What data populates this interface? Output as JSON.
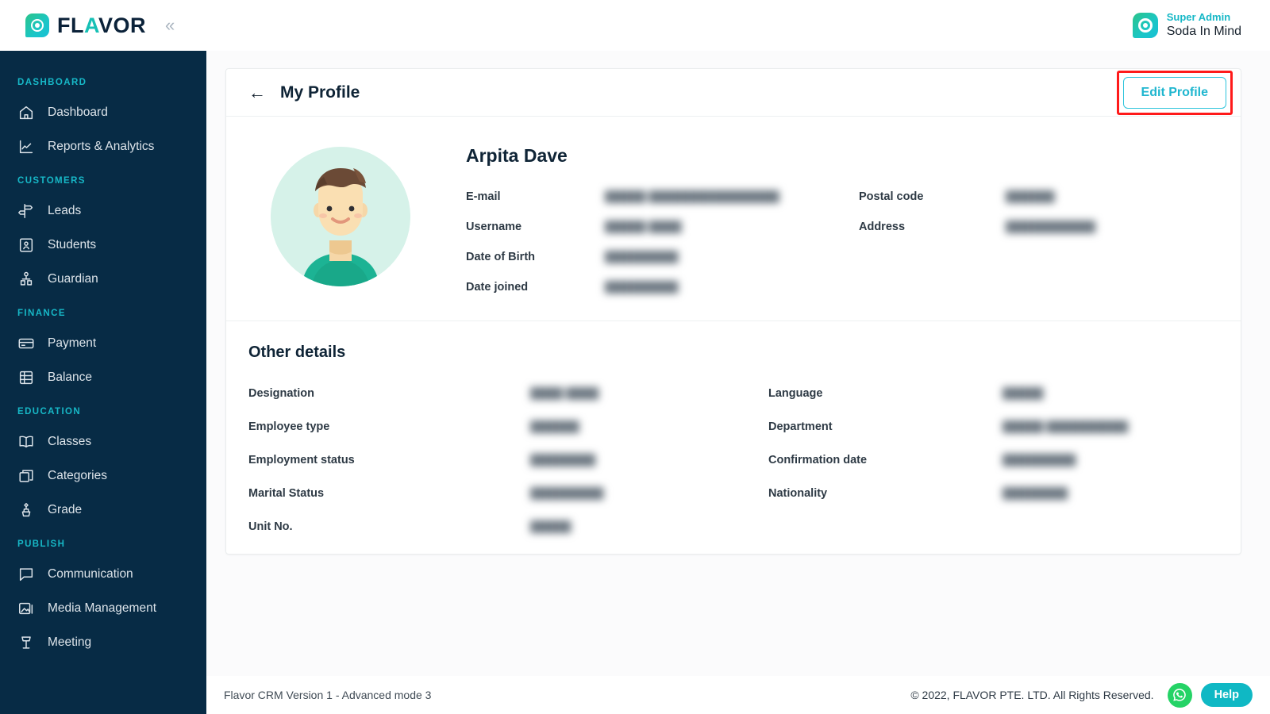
{
  "brand": {
    "logo_icon": "flavor-leaf-logo-icon",
    "name_part1": "FL",
    "name_accent": "A",
    "name_part2": "VOR",
    "collapse_icon": "chevron-double-left-icon",
    "accent_color": "#17B8C7",
    "sidebar_color": "#072B45"
  },
  "topbar": {
    "user_role": "Super Admin",
    "user_name": "Soda In Mind",
    "user_logo_icon": "flavor-leaf-avatar-icon"
  },
  "sidebar": {
    "sections": [
      {
        "label": "DASHBOARD",
        "items": [
          {
            "label": "Dashboard",
            "icon": "home-icon"
          },
          {
            "label": "Reports & Analytics",
            "icon": "chart-line-icon"
          }
        ]
      },
      {
        "label": "CUSTOMERS",
        "items": [
          {
            "label": "Leads",
            "icon": "signpost-icon"
          },
          {
            "label": "Students",
            "icon": "id-card-icon"
          },
          {
            "label": "Guardian",
            "icon": "guardian-icon"
          }
        ]
      },
      {
        "label": "FINANCE",
        "items": [
          {
            "label": "Payment",
            "icon": "credit-card-icon"
          },
          {
            "label": "Balance",
            "icon": "ledger-icon"
          }
        ]
      },
      {
        "label": "EDUCATION",
        "items": [
          {
            "label": "Classes",
            "icon": "open-book-icon"
          },
          {
            "label": "Categories",
            "icon": "boxes-icon"
          },
          {
            "label": "Grade",
            "icon": "award-icon"
          }
        ]
      },
      {
        "label": "PUBLISH",
        "items": [
          {
            "label": "Communication",
            "icon": "chat-bubble-icon"
          },
          {
            "label": "Media Management",
            "icon": "image-stack-icon"
          },
          {
            "label": "Meeting",
            "icon": "podium-icon"
          }
        ]
      }
    ]
  },
  "profile_card": {
    "back_icon": "arrow-left-icon",
    "title": "My Profile",
    "edit_button_label": "Edit Profile",
    "edit_button_border_color": "#2EC4DC",
    "highlight_color": "#FF1A1A",
    "avatar_icon": "user-illustration-avatar",
    "name": "Arpita Dave",
    "fields_left": [
      {
        "label": "E-mail",
        "value": "█████ ████████████████",
        "redacted": true
      },
      {
        "label": "Username",
        "value": "█████ ████",
        "redacted": true
      },
      {
        "label": "Date of Birth",
        "value": "█████████",
        "redacted": true
      },
      {
        "label": "Date joined",
        "value": "█████████",
        "redacted": true
      }
    ],
    "fields_right": [
      {
        "label": "Postal code",
        "value": "██████",
        "redacted": true
      },
      {
        "label": "Address",
        "value": "███████████",
        "redacted": true
      },
      {
        "label": "",
        "value": "",
        "redacted": false
      },
      {
        "label": "",
        "value": "",
        "redacted": false
      }
    ]
  },
  "other_details": {
    "title": "Other details",
    "fields_left": [
      {
        "label": "Designation",
        "value": "████ ████",
        "redacted": true
      },
      {
        "label": "Employee type",
        "value": "██████",
        "redacted": true
      },
      {
        "label": "Employment status",
        "value": "████████",
        "redacted": true
      },
      {
        "label": "Marital Status",
        "value": "█████████",
        "redacted": true
      },
      {
        "label": "Unit No.",
        "value": "█████",
        "redacted": true
      }
    ],
    "fields_right": [
      {
        "label": "Language",
        "value": "█████",
        "redacted": true
      },
      {
        "label": "Department",
        "value": "█████ ██████████",
        "redacted": true
      },
      {
        "label": "Confirmation date",
        "value": "█████████",
        "redacted": true
      },
      {
        "label": "Nationality",
        "value": "████████",
        "redacted": true
      },
      {
        "label": "",
        "value": "",
        "redacted": false
      }
    ]
  },
  "footer": {
    "version_text": "Flavor CRM Version 1 - Advanced mode 3",
    "copyright": "© 2022, FLAVOR PTE. LTD. All Rights Reserved.",
    "whatsapp_icon": "whatsapp-icon",
    "help_label": "Help",
    "help_color": "#0FB8C4",
    "whatsapp_color": "#25D366"
  }
}
